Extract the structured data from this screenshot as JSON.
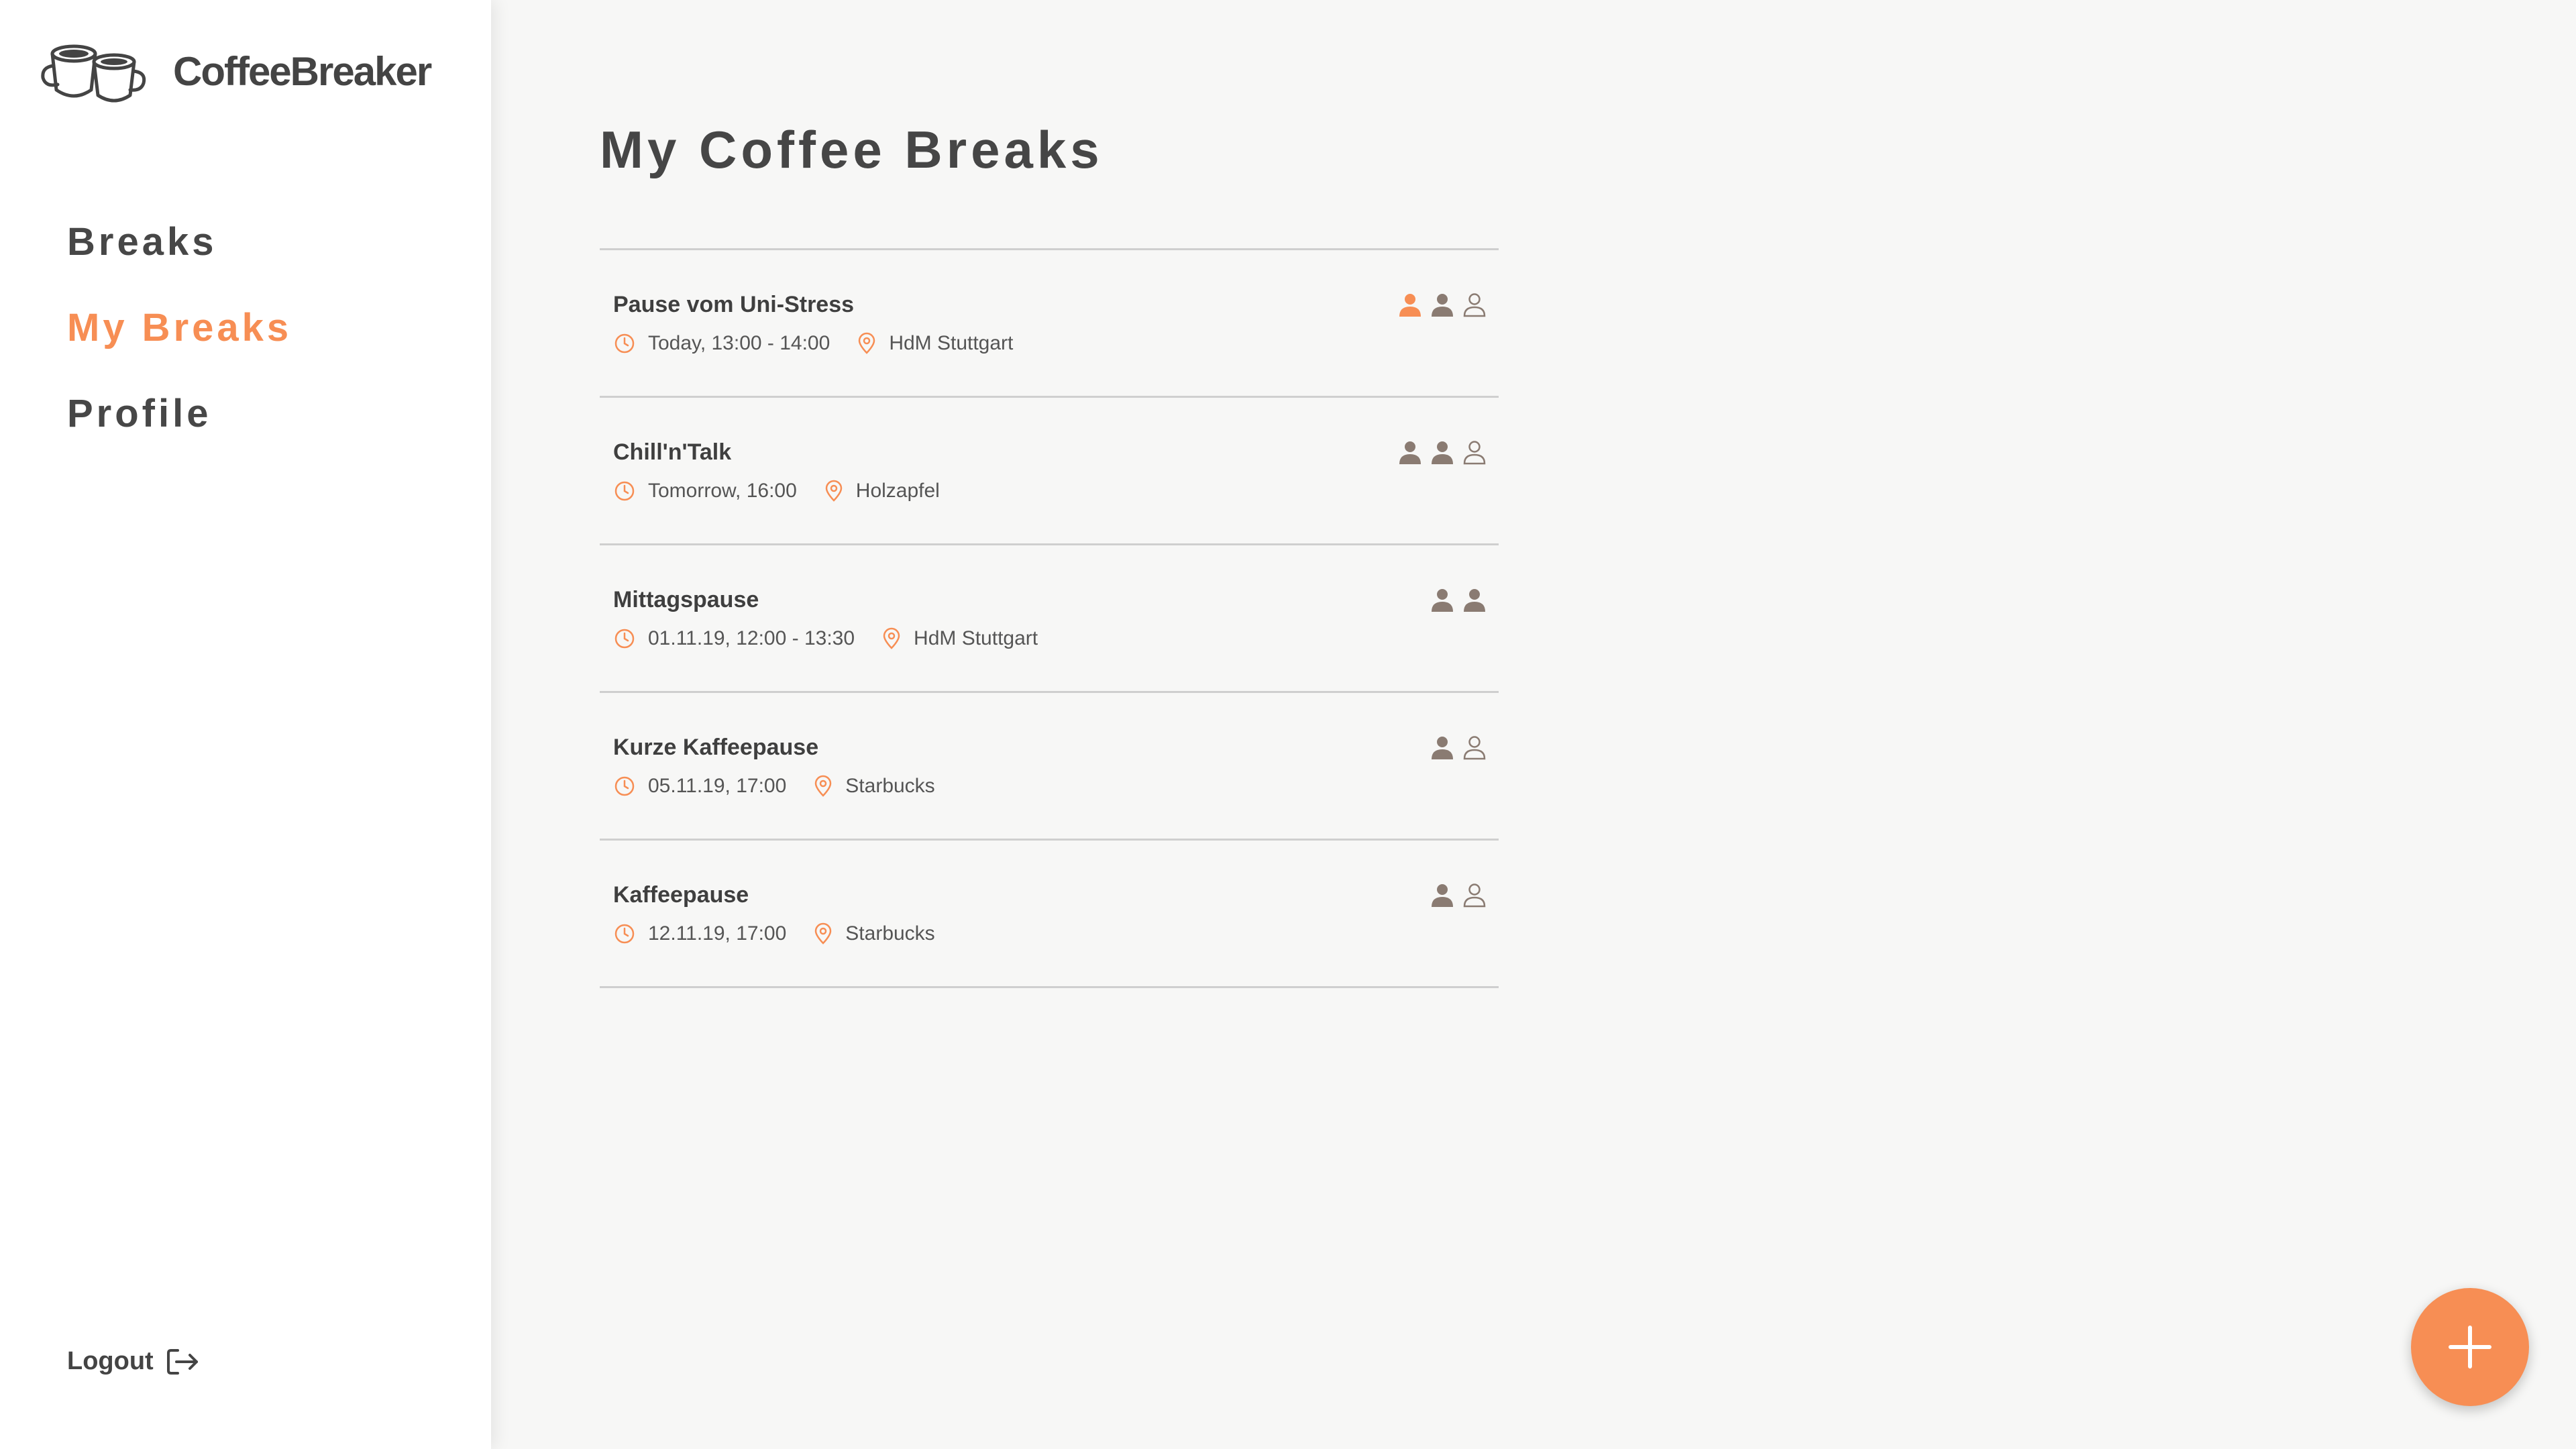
{
  "app": {
    "name": "CoffeeBreaker",
    "logo_icon": "coffee-cups-icon"
  },
  "colors": {
    "accent": "#f78e54",
    "text": "#444444",
    "participant": "#8a7b72",
    "background": "#f7f7f6",
    "sidebar": "#ffffff"
  },
  "sidebar": {
    "items": [
      {
        "label": "Breaks",
        "active": false
      },
      {
        "label": "My Breaks",
        "active": true
      },
      {
        "label": "Profile",
        "active": false
      }
    ],
    "logout_label": "Logout",
    "logout_icon": "logout-arrow-icon"
  },
  "main": {
    "title": "My Coffee Breaks",
    "breaks": [
      {
        "title": "Pause vom Uni-Stress",
        "time": "Today, 13:00 - 14:00",
        "location": "HdM Stuttgart",
        "participants": [
          "self",
          "filled",
          "empty"
        ]
      },
      {
        "title": "Chill'n'Talk",
        "time": "Tomorrow, 16:00",
        "location": "Holzapfel",
        "participants": [
          "filled",
          "filled",
          "empty"
        ]
      },
      {
        "title": "Mittagspause",
        "time": "01.11.19, 12:00 - 13:30",
        "location": "HdM Stuttgart",
        "participants": [
          "filled",
          "filled"
        ]
      },
      {
        "title": "Kurze Kaffeepause",
        "time": "05.11.19, 17:00",
        "location": "Starbucks",
        "participants": [
          "filled",
          "empty"
        ]
      },
      {
        "title": "Kaffeepause",
        "time": "12.11.19, 17:00",
        "location": "Starbucks",
        "participants": [
          "filled",
          "empty"
        ]
      }
    ]
  },
  "fab": {
    "icon": "plus-icon",
    "action": "add-break"
  }
}
